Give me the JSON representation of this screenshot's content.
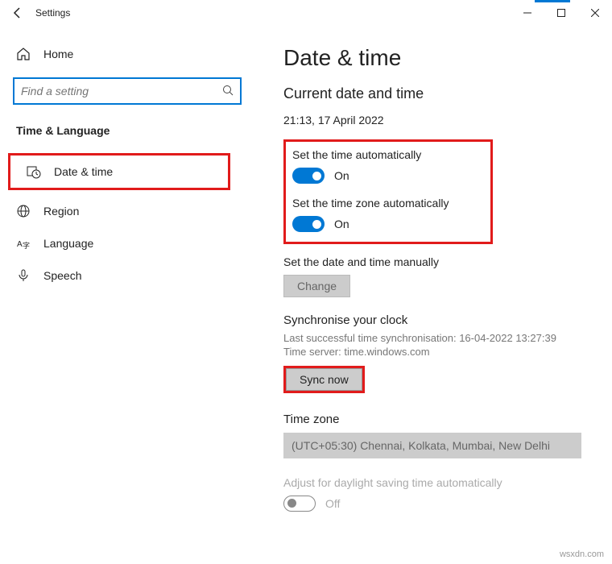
{
  "window": {
    "title": "Settings"
  },
  "sidebar": {
    "home": "Home",
    "search_placeholder": "Find a setting",
    "category": "Time & Language",
    "items": [
      {
        "label": "Date & time"
      },
      {
        "label": "Region"
      },
      {
        "label": "Language"
      },
      {
        "label": "Speech"
      }
    ]
  },
  "main": {
    "title": "Date & time",
    "subtitle": "Current date and time",
    "datetime": "21:13, 17 April 2022",
    "auto_time": {
      "label": "Set the time automatically",
      "state": "On"
    },
    "auto_tz": {
      "label": "Set the time zone automatically",
      "state": "On"
    },
    "manual": {
      "label": "Set the date and time manually",
      "button": "Change"
    },
    "sync": {
      "title": "Synchronise your clock",
      "last": "Last successful time synchronisation: 16-04-2022 13:27:39",
      "server": "Time server: time.windows.com",
      "button": "Sync now"
    },
    "tz": {
      "title": "Time zone",
      "value": "(UTC+05:30) Chennai, Kolkata, Mumbai, New Delhi"
    },
    "daylight": {
      "label": "Adjust for daylight saving time automatically",
      "state": "Off"
    }
  },
  "watermark": "wsxdn.com"
}
